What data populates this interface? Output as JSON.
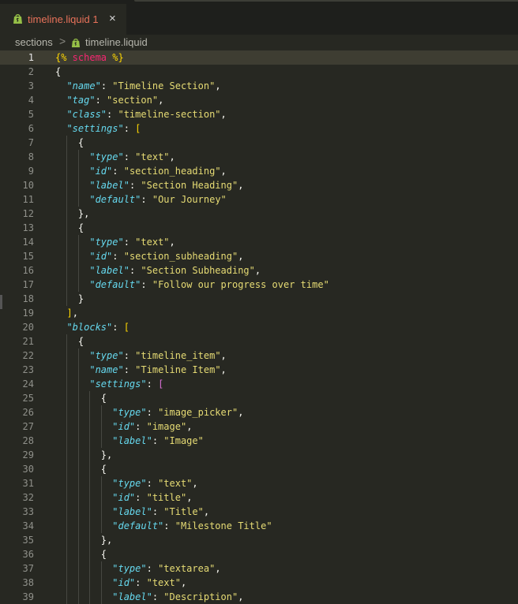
{
  "tab": {
    "filename": "timeline.liquid",
    "problems": "1",
    "close": "×"
  },
  "breadcrumb": {
    "folder": "sections",
    "separator": ">",
    "file": "timeline.liquid"
  },
  "editor": {
    "current_line": 1,
    "lines": [
      [
        {
          "t": "{%",
          "c": "y"
        },
        {
          "t": " schema ",
          "c": "lt"
        },
        {
          "t": "%}",
          "c": "y"
        }
      ],
      [
        {
          "t": "{",
          "c": "p"
        }
      ],
      [
        {
          "t": "  "
        },
        {
          "t": "\"name\"",
          "c": "k"
        },
        {
          "t": ": "
        },
        {
          "t": "\"Timeline Section\"",
          "c": "s"
        },
        {
          "t": ","
        }
      ],
      [
        {
          "t": "  "
        },
        {
          "t": "\"tag\"",
          "c": "k"
        },
        {
          "t": ": "
        },
        {
          "t": "\"section\"",
          "c": "s"
        },
        {
          "t": ","
        }
      ],
      [
        {
          "t": "  "
        },
        {
          "t": "\"class\"",
          "c": "k"
        },
        {
          "t": ": "
        },
        {
          "t": "\"timeline-section\"",
          "c": "s"
        },
        {
          "t": ","
        }
      ],
      [
        {
          "t": "  "
        },
        {
          "t": "\"settings\"",
          "c": "k"
        },
        {
          "t": ": "
        },
        {
          "t": "[",
          "c": "y"
        }
      ],
      [
        {
          "t": "    {"
        }
      ],
      [
        {
          "t": "      "
        },
        {
          "t": "\"type\"",
          "c": "k"
        },
        {
          "t": ": "
        },
        {
          "t": "\"text\"",
          "c": "s"
        },
        {
          "t": ","
        }
      ],
      [
        {
          "t": "      "
        },
        {
          "t": "\"id\"",
          "c": "k"
        },
        {
          "t": ": "
        },
        {
          "t": "\"section_heading\"",
          "c": "s"
        },
        {
          "t": ","
        }
      ],
      [
        {
          "t": "      "
        },
        {
          "t": "\"label\"",
          "c": "k"
        },
        {
          "t": ": "
        },
        {
          "t": "\"Section Heading\"",
          "c": "s"
        },
        {
          "t": ","
        }
      ],
      [
        {
          "t": "      "
        },
        {
          "t": "\"default\"",
          "c": "k"
        },
        {
          "t": ": "
        },
        {
          "t": "\"Our Journey\"",
          "c": "s"
        }
      ],
      [
        {
          "t": "    },"
        }
      ],
      [
        {
          "t": "    {"
        }
      ],
      [
        {
          "t": "      "
        },
        {
          "t": "\"type\"",
          "c": "k"
        },
        {
          "t": ": "
        },
        {
          "t": "\"text\"",
          "c": "s"
        },
        {
          "t": ","
        }
      ],
      [
        {
          "t": "      "
        },
        {
          "t": "\"id\"",
          "c": "k"
        },
        {
          "t": ": "
        },
        {
          "t": "\"section_subheading\"",
          "c": "s"
        },
        {
          "t": ","
        }
      ],
      [
        {
          "t": "      "
        },
        {
          "t": "\"label\"",
          "c": "k"
        },
        {
          "t": ": "
        },
        {
          "t": "\"Section Subheading\"",
          "c": "s"
        },
        {
          "t": ","
        }
      ],
      [
        {
          "t": "      "
        },
        {
          "t": "\"default\"",
          "c": "k"
        },
        {
          "t": ": "
        },
        {
          "t": "\"Follow our progress over time\"",
          "c": "s"
        }
      ],
      [
        {
          "t": "    }"
        }
      ],
      [
        {
          "t": "  "
        },
        {
          "t": "]",
          "c": "y"
        },
        {
          "t": ","
        }
      ],
      [
        {
          "t": "  "
        },
        {
          "t": "\"blocks\"",
          "c": "k"
        },
        {
          "t": ": "
        },
        {
          "t": "[",
          "c": "y"
        }
      ],
      [
        {
          "t": "    {"
        }
      ],
      [
        {
          "t": "      "
        },
        {
          "t": "\"type\"",
          "c": "k"
        },
        {
          "t": ": "
        },
        {
          "t": "\"timeline_item\"",
          "c": "s"
        },
        {
          "t": ","
        }
      ],
      [
        {
          "t": "      "
        },
        {
          "t": "\"name\"",
          "c": "k"
        },
        {
          "t": ": "
        },
        {
          "t": "\"Timeline Item\"",
          "c": "s"
        },
        {
          "t": ","
        }
      ],
      [
        {
          "t": "      "
        },
        {
          "t": "\"settings\"",
          "c": "k"
        },
        {
          "t": ": "
        },
        {
          "t": "[",
          "c": "m"
        }
      ],
      [
        {
          "t": "        {"
        }
      ],
      [
        {
          "t": "          "
        },
        {
          "t": "\"type\"",
          "c": "k"
        },
        {
          "t": ": "
        },
        {
          "t": "\"image_picker\"",
          "c": "s"
        },
        {
          "t": ","
        }
      ],
      [
        {
          "t": "          "
        },
        {
          "t": "\"id\"",
          "c": "k"
        },
        {
          "t": ": "
        },
        {
          "t": "\"image\"",
          "c": "s"
        },
        {
          "t": ","
        }
      ],
      [
        {
          "t": "          "
        },
        {
          "t": "\"label\"",
          "c": "k"
        },
        {
          "t": ": "
        },
        {
          "t": "\"Image\"",
          "c": "s"
        }
      ],
      [
        {
          "t": "        },"
        }
      ],
      [
        {
          "t": "        {"
        }
      ],
      [
        {
          "t": "          "
        },
        {
          "t": "\"type\"",
          "c": "k"
        },
        {
          "t": ": "
        },
        {
          "t": "\"text\"",
          "c": "s"
        },
        {
          "t": ","
        }
      ],
      [
        {
          "t": "          "
        },
        {
          "t": "\"id\"",
          "c": "k"
        },
        {
          "t": ": "
        },
        {
          "t": "\"title\"",
          "c": "s"
        },
        {
          "t": ","
        }
      ],
      [
        {
          "t": "          "
        },
        {
          "t": "\"label\"",
          "c": "k"
        },
        {
          "t": ": "
        },
        {
          "t": "\"Title\"",
          "c": "s"
        },
        {
          "t": ","
        }
      ],
      [
        {
          "t": "          "
        },
        {
          "t": "\"default\"",
          "c": "k"
        },
        {
          "t": ": "
        },
        {
          "t": "\"Milestone Title\"",
          "c": "s"
        }
      ],
      [
        {
          "t": "        },"
        }
      ],
      [
        {
          "t": "        {"
        }
      ],
      [
        {
          "t": "          "
        },
        {
          "t": "\"type\"",
          "c": "k"
        },
        {
          "t": ": "
        },
        {
          "t": "\"textarea\"",
          "c": "s"
        },
        {
          "t": ","
        }
      ],
      [
        {
          "t": "          "
        },
        {
          "t": "\"id\"",
          "c": "k"
        },
        {
          "t": ": "
        },
        {
          "t": "\"text\"",
          "c": "s"
        },
        {
          "t": ","
        }
      ],
      [
        {
          "t": "          "
        },
        {
          "t": "\"label\"",
          "c": "k"
        },
        {
          "t": ": "
        },
        {
          "t": "\"Description\"",
          "c": "s"
        },
        {
          "t": ","
        }
      ]
    ]
  }
}
